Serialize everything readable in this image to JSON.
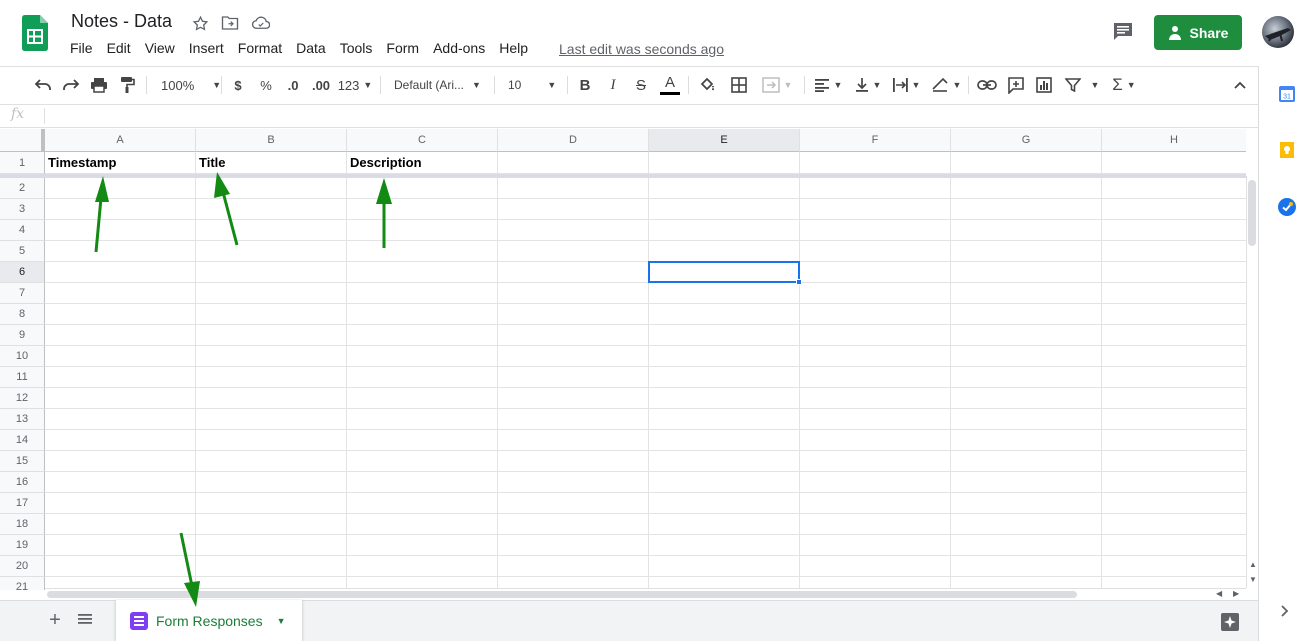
{
  "app": {
    "title": "Notes - Data",
    "last_edit": "Last edit was seconds ago",
    "share_label": "Share"
  },
  "menu": [
    "File",
    "Edit",
    "View",
    "Insert",
    "Format",
    "Data",
    "Tools",
    "Form",
    "Add-ons",
    "Help"
  ],
  "toolbar": {
    "zoom": "100%",
    "currency": "$",
    "percent": "%",
    "dec_decrease": ".0",
    "dec_increase": ".00",
    "more_formats": "123",
    "font": "Default (Ari...",
    "font_size": "10",
    "bold": "B",
    "italic": "I",
    "strike": "S",
    "text_color": "A",
    "functions": "Σ"
  },
  "formula_bar": {
    "fx_label": "fx",
    "value": ""
  },
  "grid": {
    "columns": [
      "A",
      "B",
      "C",
      "D",
      "E",
      "F",
      "G",
      "H"
    ],
    "rows": [
      "1",
      "2",
      "3",
      "4",
      "5",
      "6",
      "7",
      "8",
      "9",
      "10",
      "11",
      "12",
      "13",
      "14",
      "15",
      "16",
      "17",
      "18",
      "19",
      "20",
      "21"
    ],
    "header_row": [
      "Timestamp",
      "Title",
      "Description"
    ],
    "selected_cell": "E6"
  },
  "sheets": [
    {
      "name": "Form Responses",
      "active": true
    }
  ],
  "colors": {
    "accent_green": "#1e8e3e",
    "arrow_green": "#138a13",
    "selection_blue": "#1a73e8",
    "form_purple": "#7e3ff2"
  }
}
